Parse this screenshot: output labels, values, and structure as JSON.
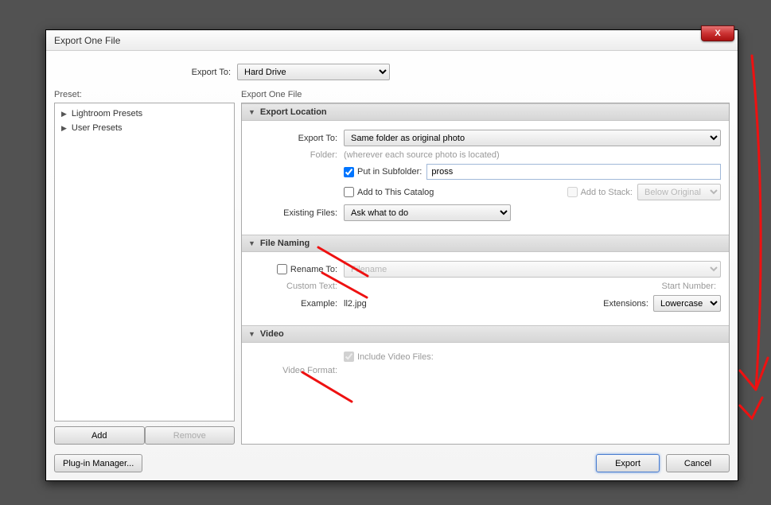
{
  "window": {
    "title": "Export One File"
  },
  "exportTo": {
    "label": "Export To:",
    "value": "Hard Drive"
  },
  "preset": {
    "heading": "Preset:",
    "items": [
      "Lightroom Presets",
      "User Presets"
    ],
    "add": "Add",
    "remove": "Remove"
  },
  "mainHeading": "Export One File",
  "sections": {
    "location": {
      "title": "Export Location",
      "exportTo": {
        "label": "Export To:",
        "value": "Same folder as original photo"
      },
      "folder": {
        "label": "Folder:",
        "value": "(wherever each source photo is located)"
      },
      "putInSubfolder": {
        "label": "Put in Subfolder:",
        "checked": true,
        "value": "pross"
      },
      "addCatalog": {
        "label": "Add to This Catalog",
        "checked": false
      },
      "addStack": {
        "label": "Add to Stack:",
        "checked": false
      },
      "belowOriginal": "Below Original",
      "existing": {
        "label": "Existing Files:",
        "value": "Ask what to do"
      }
    },
    "naming": {
      "title": "File Naming",
      "rename": {
        "label": "Rename To:",
        "checked": false,
        "value": "Filename"
      },
      "customText": {
        "label": "Custom Text:"
      },
      "startNumber": {
        "label": "Start Number:"
      },
      "example": {
        "label": "Example:",
        "value": "ll2.jpg"
      },
      "extensions": {
        "label": "Extensions:",
        "value": "Lowercase"
      }
    },
    "video": {
      "title": "Video",
      "include": {
        "label": "Include Video Files:",
        "checked": true
      },
      "format": {
        "label": "Video Format:"
      }
    }
  },
  "footer": {
    "plugin": "Plug-in Manager...",
    "export": "Export",
    "cancel": "Cancel"
  },
  "closeX": "X"
}
